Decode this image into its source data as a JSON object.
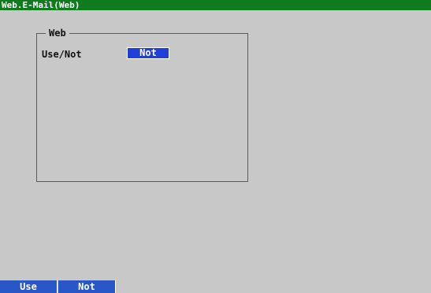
{
  "window": {
    "title": "Web.E-Mail(Web)"
  },
  "web_group": {
    "title": "Web",
    "use_not": {
      "label": "Use/Not",
      "value": "Not"
    }
  },
  "softkeys": [
    {
      "label": "Use"
    },
    {
      "label": "Not"
    }
  ],
  "colors": {
    "title_bar": "#0f7a1e",
    "background": "#c8c8c8",
    "selected_value": "#2140d9",
    "softkey": "#2a57c8"
  }
}
